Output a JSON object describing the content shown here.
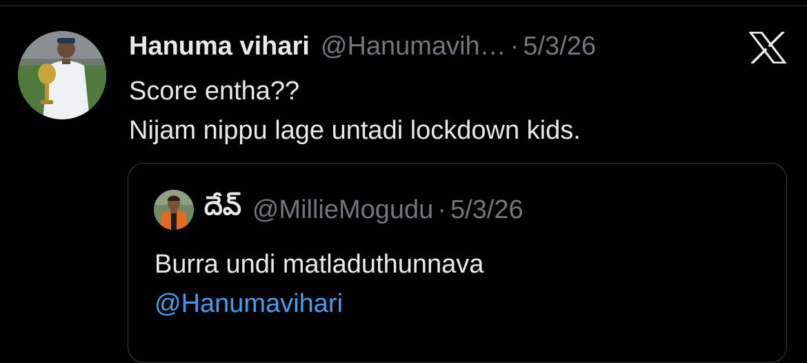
{
  "tweet": {
    "author": {
      "display_name": "Hanuma vihari",
      "handle": "@Hanumavih…",
      "avatar_icon": "user-avatar-cricketer-with-trophy"
    },
    "separator": "·",
    "date": "5/3/26",
    "text_lines": [
      "Score entha??",
      "Nijam nippu lage untadi lockdown kids."
    ],
    "platform_icon": "x-logo-icon"
  },
  "quoted_tweet": {
    "author": {
      "display_name": "దేవ్",
      "handle": "@MillieMogudu",
      "avatar_icon": "user-avatar-player-orange-jersey"
    },
    "separator": "·",
    "date": "5/3/26",
    "text_line": "Burra undi matladuthunnava",
    "mention": "@Hanumavihari"
  },
  "colors": {
    "background": "#000000",
    "primary_text": "#e7e9ea",
    "secondary_text": "#71767b",
    "link": "#4c9bea",
    "border": "#3a3f44"
  }
}
